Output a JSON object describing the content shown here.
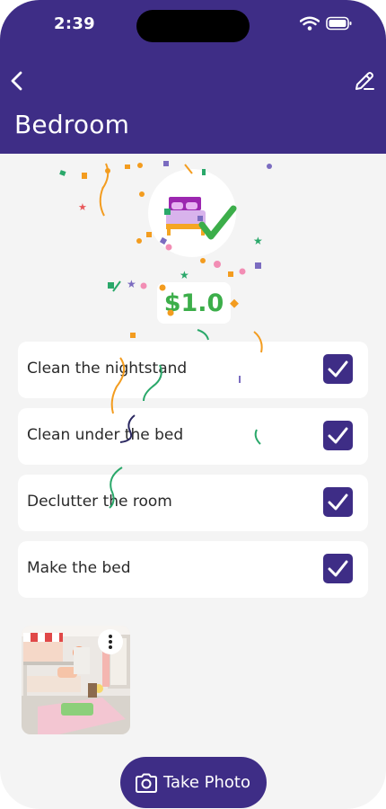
{
  "status_bar": {
    "time": "2:39"
  },
  "header": {
    "title": "Bedroom"
  },
  "reward": {
    "amount": "$1.0"
  },
  "tasks": [
    {
      "label": "Clean the nightstand",
      "checked": true
    },
    {
      "label": "Clean under the bed",
      "checked": true
    },
    {
      "label": "Declutter the room",
      "checked": true
    },
    {
      "label": "Make the bed",
      "checked": true
    }
  ],
  "take_photo": {
    "label": "Take Photo"
  },
  "colors": {
    "primary": "#3e2d86",
    "reward_green": "#3cae4a",
    "background": "#f4f4f4"
  }
}
